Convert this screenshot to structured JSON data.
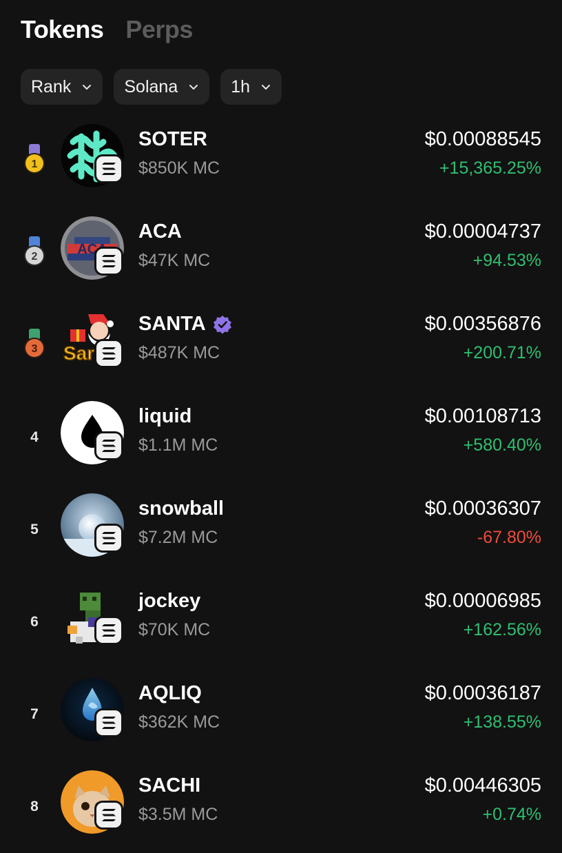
{
  "tabs": [
    {
      "label": "Tokens",
      "active": true
    },
    {
      "label": "Perps",
      "active": false
    }
  ],
  "filters": {
    "sort": "Rank",
    "chain": "Solana",
    "timeframe": "1h"
  },
  "colors": {
    "background": "#121212",
    "positive": "#2fbf71",
    "negative": "#f04b3b",
    "muted": "#9a9a9a"
  },
  "tokens": [
    {
      "rank": "1",
      "name": "SOTER",
      "mc": "$850K MC",
      "price": "$0.00088545",
      "change": "+15,365.25%",
      "direction": "up",
      "verified": false,
      "medal": "gold",
      "logo": "soter-logo",
      "chain_icon": "solana-icon"
    },
    {
      "rank": "2",
      "name": "ACA",
      "mc": "$47K MC",
      "price": "$0.00004737",
      "change": "+94.53%",
      "direction": "up",
      "verified": false,
      "medal": "silver",
      "logo": "aca-logo",
      "chain_icon": "solana-icon"
    },
    {
      "rank": "3",
      "name": "SANTA",
      "mc": "$487K MC",
      "price": "$0.00356876",
      "change": "+200.71%",
      "direction": "up",
      "verified": true,
      "medal": "bronze",
      "logo": "santa-logo",
      "chain_icon": "solana-icon"
    },
    {
      "rank": "4",
      "name": "liquid",
      "mc": "$1.1M MC",
      "price": "$0.00108713",
      "change": "+580.40%",
      "direction": "up",
      "verified": false,
      "medal": null,
      "logo": "liquid-logo",
      "chain_icon": "solana-icon"
    },
    {
      "rank": "5",
      "name": "snowball",
      "mc": "$7.2M MC",
      "price": "$0.00036307",
      "change": "-67.80%",
      "direction": "down",
      "verified": false,
      "medal": null,
      "logo": "snowball-logo",
      "chain_icon": "solana-icon"
    },
    {
      "rank": "6",
      "name": "jockey",
      "mc": "$70K MC",
      "price": "$0.00006985",
      "change": "+162.56%",
      "direction": "up",
      "verified": false,
      "medal": null,
      "logo": "jockey-logo",
      "chain_icon": "solana-icon"
    },
    {
      "rank": "7",
      "name": "AQLIQ",
      "mc": "$362K MC",
      "price": "$0.00036187",
      "change": "+138.55%",
      "direction": "up",
      "verified": false,
      "medal": null,
      "logo": "aqliq-logo",
      "chain_icon": "solana-icon"
    },
    {
      "rank": "8",
      "name": "SACHI",
      "mc": "$3.5M MC",
      "price": "$0.00446305",
      "change": "+0.74%",
      "direction": "up",
      "verified": false,
      "medal": null,
      "logo": "sachi-logo",
      "chain_icon": "solana-icon"
    }
  ]
}
